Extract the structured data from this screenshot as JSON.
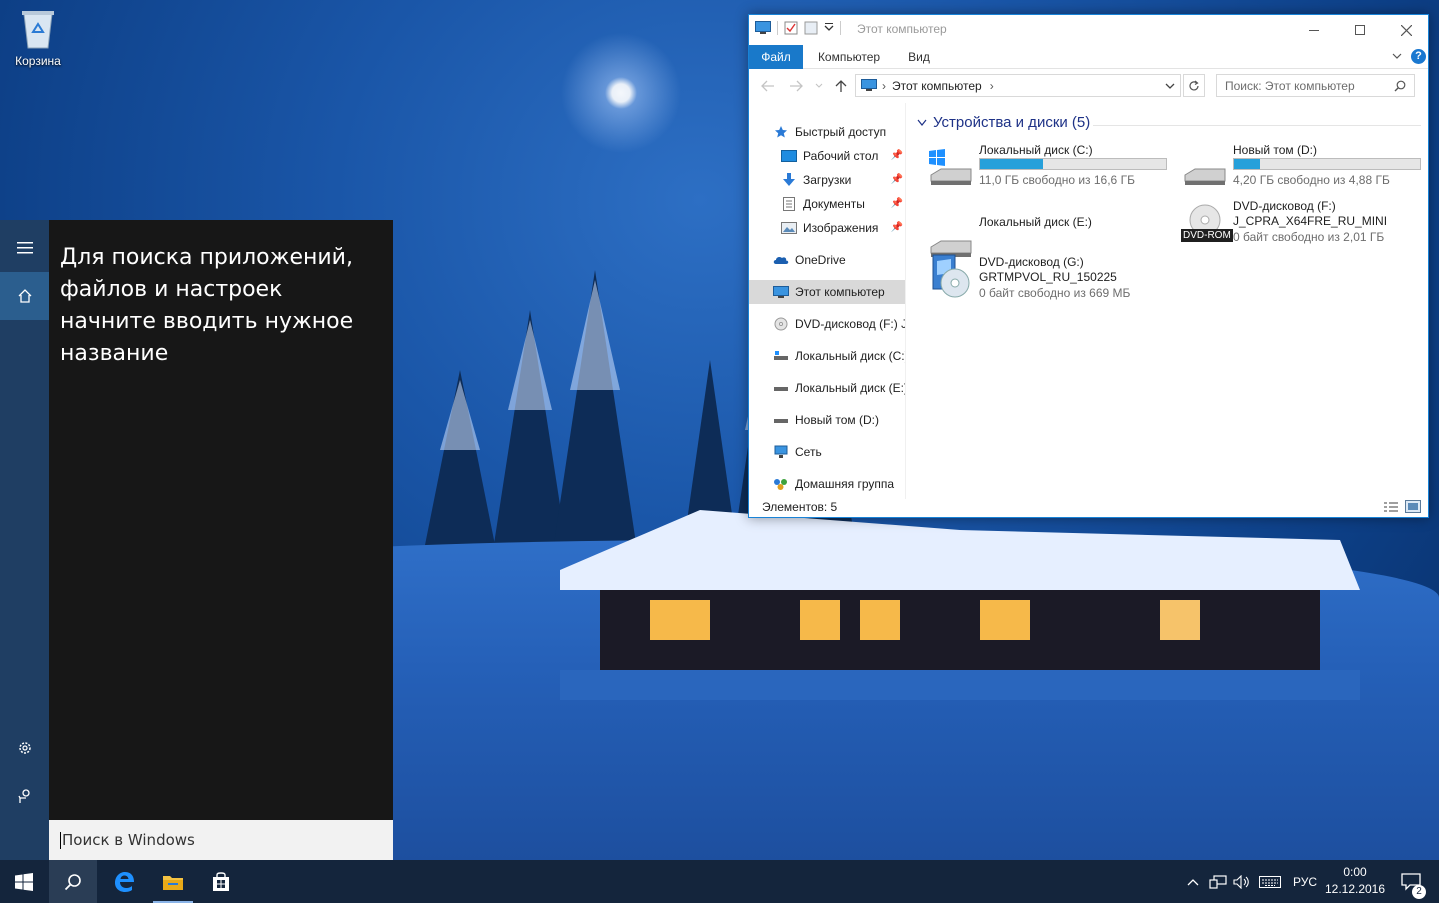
{
  "desktop": {
    "icons": [
      {
        "label": "Корзина",
        "icon": "recycle-bin-icon"
      }
    ]
  },
  "start": {
    "hint": "Для поиска приложений, файлов и настроек начните вводить нужное название",
    "search_placeholder": "Поиск в Windows",
    "rail": [
      "hamburger-menu-icon",
      "home-icon",
      "settings-icon",
      "feedback-icon"
    ]
  },
  "taskbar": {
    "apps": [
      "start-icon",
      "search-icon",
      "edge-icon",
      "file-explorer-icon",
      "store-icon"
    ],
    "language": "РУС",
    "time": "0:00",
    "date": "12.12.2016",
    "notifications_count": "2"
  },
  "explorer": {
    "title": "Этот компьютер",
    "ribbon_tabs": [
      "Файл",
      "Компьютер",
      "Вид"
    ],
    "address": "Этот компьютер",
    "search_placeholder": "Поиск: Этот компьютер",
    "nav": [
      {
        "label": "Быстрый доступ",
        "icon": "star-icon",
        "pinned": false,
        "indent": false
      },
      {
        "label": "Рабочий стол",
        "icon": "desktop-icon",
        "pinned": true,
        "indent": true
      },
      {
        "label": "Загрузки",
        "icon": "download-icon",
        "pinned": true,
        "indent": true
      },
      {
        "label": "Документы",
        "icon": "document-icon",
        "pinned": true,
        "indent": true
      },
      {
        "label": "Изображения",
        "icon": "pictures-icon",
        "pinned": true,
        "indent": true
      },
      {
        "label": "OneDrive",
        "icon": "cloud-icon",
        "pinned": false,
        "indent": false
      },
      {
        "label": "Этот компьютер",
        "icon": "computer-icon",
        "pinned": false,
        "indent": false,
        "selected": true
      },
      {
        "label": "DVD-дисковод (F:) J_",
        "icon": "dvd-icon",
        "pinned": false,
        "indent": false
      },
      {
        "label": "Локальный диск (C:)",
        "icon": "drive-icon",
        "pinned": false,
        "indent": false
      },
      {
        "label": "Локальный диск (E:)",
        "icon": "drive-icon",
        "pinned": false,
        "indent": false
      },
      {
        "label": "Новый том (D:)",
        "icon": "drive-icon",
        "pinned": false,
        "indent": false
      },
      {
        "label": "Сеть",
        "icon": "network-icon",
        "pinned": false,
        "indent": false
      },
      {
        "label": "Домашняя группа",
        "icon": "homegroup-icon",
        "pinned": false,
        "indent": false
      }
    ],
    "group_title": "Устройства и диски (5)",
    "drives": [
      {
        "name": "Локальный диск (C:)",
        "free": "11,0 ГБ свободно из 16,6 ГБ",
        "used_fraction": 0.34,
        "icon": "windows-drive-icon"
      },
      {
        "name": "Новый том (D:)",
        "free": "4,20 ГБ свободно из 4,88 ГБ",
        "used_fraction": 0.14,
        "icon": "drive-icon"
      },
      {
        "name": "Локальный диск (E:)",
        "icon": "drive-icon"
      },
      {
        "name": "DVD-дисковод (F:)",
        "name2": "J_CPRA_X64FRE_RU_MINI",
        "free": "0 байт свободно из 2,01 ГБ",
        "badge": "DVD-ROM",
        "icon": "dvd-icon"
      },
      {
        "name": "DVD-дисковод (G:)",
        "name2": "GRTMPVOL_RU_150225",
        "free": "0 байт свободно из 669 МБ",
        "icon": "setup-dvd-icon"
      }
    ],
    "status": "Элементов: 5"
  },
  "colors": {
    "accent": "#1979ca",
    "taskbar": "#14253c",
    "bar_fill": "#26a0da"
  }
}
